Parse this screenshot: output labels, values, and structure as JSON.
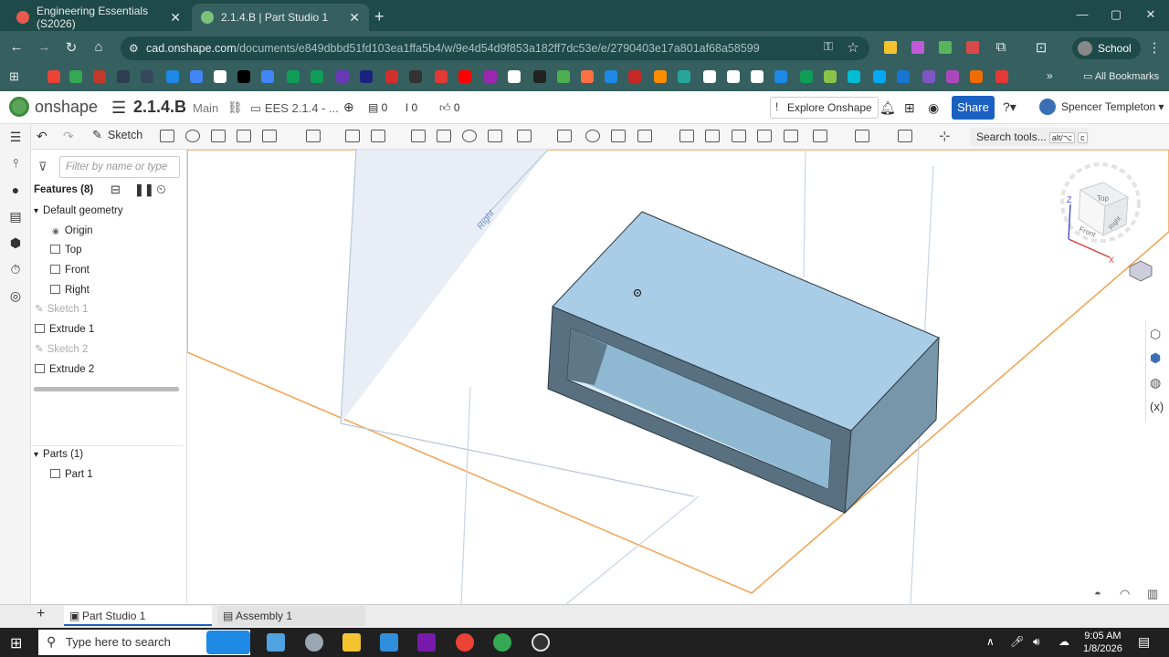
{
  "browser": {
    "tabs": [
      {
        "title": "Engineering Essentials (S2026)"
      },
      {
        "title": "2.1.4.B | Part Studio 1"
      }
    ],
    "url_host": "cad.onshape.com",
    "url_path": "/documents/e849dbbd51fd103ea1ffa5b4/w/9e4d54d9f853a182ff7dc53e/e/2790403e17a801af68a58599",
    "profile": "School",
    "all_bookmarks": "All Bookmarks"
  },
  "onshape": {
    "logo_text": "onshape",
    "doc_title": "2.1.4.B",
    "branch": "Main",
    "workspace": "EES 2.1.4 - ...",
    "count1": "0",
    "count2": "0",
    "count3": "0",
    "explore": "Explore Onshape",
    "share": "Share",
    "user": "Spencer Templeton"
  },
  "toolbar": {
    "sketch": "Sketch",
    "search": "Search tools...",
    "key1": "alt/⌥",
    "key2": "c"
  },
  "feature_panel": {
    "filter_placeholder": "Filter by name or type",
    "features_header": "Features (8)",
    "default_geometry": "Default geometry",
    "items": [
      "Origin",
      "Top",
      "Front",
      "Right",
      "Sketch 1",
      "Extrude 1",
      "Sketch 2",
      "Extrude 2"
    ],
    "parts_header": "Parts (1)",
    "parts": [
      "Part 1"
    ]
  },
  "viewport": {
    "plane_label": "Right",
    "cube_top": "Top",
    "cube_front": "Front",
    "cube_right": "Right",
    "axis_z": "Z",
    "axis_x": "X"
  },
  "bottom_tabs": [
    "Part Studio 1",
    "Assembly 1"
  ],
  "taskbar": {
    "search": "Type here to search",
    "time": "9:05 AM",
    "date": "1/8/2026"
  },
  "colors": {
    "part_fill": "#a9cde6",
    "part_side": "#6f8fa3",
    "plane": "#f2a65a",
    "share": "#1b61c1"
  }
}
